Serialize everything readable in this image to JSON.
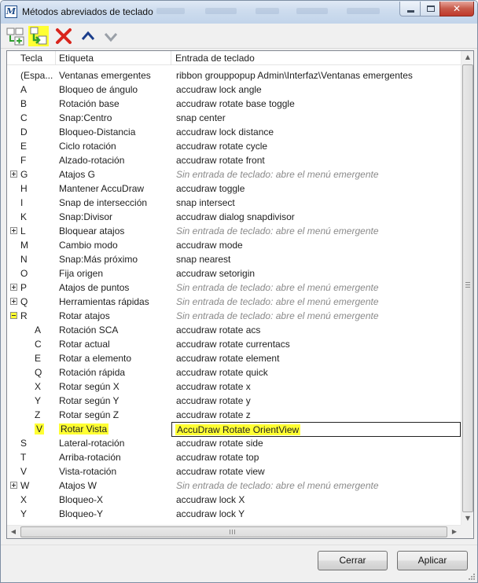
{
  "window": {
    "title": "Métodos abreviados de teclado",
    "app_icon_letter": "M",
    "close_glyph": "✕"
  },
  "toolbar": {
    "buttons": [
      {
        "name": "add-keyin-icon",
        "highlighted": false
      },
      {
        "name": "add-child-keyin-icon",
        "highlighted": true
      },
      {
        "name": "delete-icon",
        "highlighted": false
      },
      {
        "name": "move-up-icon",
        "highlighted": false
      },
      {
        "name": "move-down-icon",
        "highlighted": false
      }
    ]
  },
  "columns": {
    "key": "Tecla",
    "label": "Etiqueta",
    "keyin": "Entrada de teclado"
  },
  "rows": [
    {
      "key": "(Espa...",
      "label": "Ventanas emergentes",
      "keyin": "ribbon grouppopup Admin\\Interfaz\\Ventanas emergentes",
      "indent": 0,
      "expander": "",
      "italic": false,
      "highlight": false
    },
    {
      "key": "A",
      "label": "Bloqueo de ángulo",
      "keyin": "accudraw lock angle",
      "indent": 0,
      "expander": "",
      "italic": false,
      "highlight": false
    },
    {
      "key": "B",
      "label": "Rotación base",
      "keyin": "accudraw rotate base toggle",
      "indent": 0,
      "expander": "",
      "italic": false,
      "highlight": false
    },
    {
      "key": "C",
      "label": "Snap:Centro",
      "keyin": "snap center",
      "indent": 0,
      "expander": "",
      "italic": false,
      "highlight": false
    },
    {
      "key": "D",
      "label": "Bloqueo-Distancia",
      "keyin": "accudraw lock distance",
      "indent": 0,
      "expander": "",
      "italic": false,
      "highlight": false
    },
    {
      "key": "E",
      "label": "Ciclo rotación",
      "keyin": "accudraw rotate cycle",
      "indent": 0,
      "expander": "",
      "italic": false,
      "highlight": false
    },
    {
      "key": "F",
      "label": "Alzado-rotación",
      "keyin": "accudraw rotate front",
      "indent": 0,
      "expander": "",
      "italic": false,
      "highlight": false
    },
    {
      "key": "G",
      "label": "Atajos G",
      "keyin": "Sin entrada de teclado: abre el menú emergente",
      "indent": 0,
      "expander": "plus",
      "italic": true,
      "highlight": false
    },
    {
      "key": "H",
      "label": "Mantener AccuDraw",
      "keyin": "accudraw toggle",
      "indent": 0,
      "expander": "",
      "italic": false,
      "highlight": false
    },
    {
      "key": "I",
      "label": "Snap de intersección",
      "keyin": "snap intersect",
      "indent": 0,
      "expander": "",
      "italic": false,
      "highlight": false
    },
    {
      "key": "K",
      "label": "Snap:Divisor",
      "keyin": "accudraw dialog snapdivisor",
      "indent": 0,
      "expander": "",
      "italic": false,
      "highlight": false
    },
    {
      "key": "L",
      "label": "Bloquear atajos",
      "keyin": "Sin entrada de teclado: abre el menú emergente",
      "indent": 0,
      "expander": "plus",
      "italic": true,
      "highlight": false
    },
    {
      "key": "M",
      "label": "Cambio modo",
      "keyin": "accudraw mode",
      "indent": 0,
      "expander": "",
      "italic": false,
      "highlight": false
    },
    {
      "key": "N",
      "label": "Snap:Más próximo",
      "keyin": "snap nearest",
      "indent": 0,
      "expander": "",
      "italic": false,
      "highlight": false
    },
    {
      "key": "O",
      "label": "Fija origen",
      "keyin": "accudraw setorigin",
      "indent": 0,
      "expander": "",
      "italic": false,
      "highlight": false
    },
    {
      "key": "P",
      "label": "Atajos de puntos",
      "keyin": "Sin entrada de teclado: abre el menú emergente",
      "indent": 0,
      "expander": "plus",
      "italic": true,
      "highlight": false
    },
    {
      "key": "Q",
      "label": "Herramientas rápidas",
      "keyin": "Sin entrada de teclado: abre el menú emergente",
      "indent": 0,
      "expander": "plus",
      "italic": true,
      "highlight": false
    },
    {
      "key": "R",
      "label": "Rotar atajos",
      "keyin": "Sin entrada de teclado: abre el menú emergente",
      "indent": 0,
      "expander": "minus",
      "italic": true,
      "highlight": false
    },
    {
      "key": "A",
      "label": "Rotación SCA",
      "keyin": "accudraw rotate acs",
      "indent": 1,
      "expander": "",
      "italic": false,
      "highlight": false
    },
    {
      "key": "C",
      "label": "Rotar actual",
      "keyin": "accudraw rotate currentacs",
      "indent": 1,
      "expander": "",
      "italic": false,
      "highlight": false
    },
    {
      "key": "E",
      "label": "Rotar a elemento",
      "keyin": "accudraw rotate element",
      "indent": 1,
      "expander": "",
      "italic": false,
      "highlight": false
    },
    {
      "key": "Q",
      "label": "Rotación rápida",
      "keyin": "accudraw rotate quick",
      "indent": 1,
      "expander": "",
      "italic": false,
      "highlight": false
    },
    {
      "key": "X",
      "label": "Rotar según X",
      "keyin": "accudraw rotate x",
      "indent": 1,
      "expander": "",
      "italic": false,
      "highlight": false
    },
    {
      "key": "Y",
      "label": "Rotar según Y",
      "keyin": "accudraw rotate y",
      "indent": 1,
      "expander": "",
      "italic": false,
      "highlight": false
    },
    {
      "key": "Z",
      "label": "Rotar según Z",
      "keyin": "accudraw rotate z",
      "indent": 1,
      "expander": "",
      "italic": false,
      "highlight": false
    },
    {
      "key": "V",
      "label": "Rotar Vista",
      "keyin": "AccuDraw Rotate OrientView",
      "indent": 1,
      "expander": "",
      "italic": false,
      "highlight": true
    },
    {
      "key": "S",
      "label": "Lateral-rotación",
      "keyin": "accudraw rotate side",
      "indent": 0,
      "expander": "",
      "italic": false,
      "highlight": false
    },
    {
      "key": "T",
      "label": "Arriba-rotación",
      "keyin": "accudraw rotate top",
      "indent": 0,
      "expander": "",
      "italic": false,
      "highlight": false
    },
    {
      "key": "V",
      "label": "Vista-rotación",
      "keyin": "accudraw rotate view",
      "indent": 0,
      "expander": "",
      "italic": false,
      "highlight": false
    },
    {
      "key": "W",
      "label": "Atajos W",
      "keyin": "Sin entrada de teclado: abre el menú emergente",
      "indent": 0,
      "expander": "plus",
      "italic": true,
      "highlight": false
    },
    {
      "key": "X",
      "label": "Bloqueo-X",
      "keyin": "accudraw lock X",
      "indent": 0,
      "expander": "",
      "italic": false,
      "highlight": false
    },
    {
      "key": "Y",
      "label": "Bloqueo-Y",
      "keyin": "accudraw lock Y",
      "indent": 0,
      "expander": "",
      "italic": false,
      "highlight": false
    }
  ],
  "scrollbar": {
    "horizontal_grip": "III",
    "up_arrow": "▲",
    "down_arrow": "▼",
    "left_arrow": "◀",
    "right_arrow": "▶"
  },
  "buttons": {
    "cancel": "Cerrar",
    "apply": "Aplicar"
  },
  "colors": {
    "highlight": "#ffff33",
    "delete_red": "#d9251c",
    "arrow_blue": "#1c3f8c",
    "placeholder_gray": "#8a8a8a"
  }
}
